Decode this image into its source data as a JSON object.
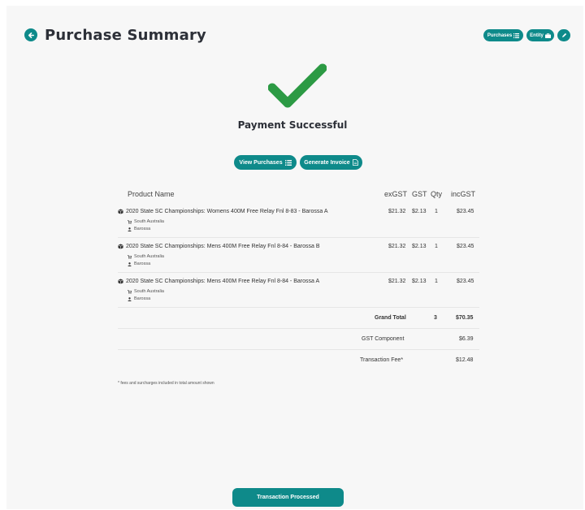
{
  "header": {
    "title": "Purchase Summary",
    "back_icon": "arrow-left-icon",
    "nav_purchases_label": "Purchases",
    "nav_entity_label": "Entity"
  },
  "status": {
    "message": "Payment Successful",
    "icon": "checkmark-icon",
    "success_color": "#2c9a44"
  },
  "actions": {
    "view_purchases_label": "View Purchases",
    "generate_invoice_label": "Generate Invoice"
  },
  "table": {
    "columns": {
      "product": "Product Name",
      "ex_gst": "exGST",
      "gst": "GST",
      "qty": "Qty",
      "inc_gst": "incGST"
    },
    "rows": [
      {
        "name": "2020 State SC Championships: Womens 400M Free Relay Fnl 8-83 - Barossa A",
        "region": "South Australia",
        "club": "Barossa",
        "ex_gst": "$21.32",
        "gst": "$2.13",
        "qty": "1",
        "inc_gst": "$23.45"
      },
      {
        "name": "2020 State SC Championships: Mens 400M Free Relay Fnl 8-84 - Barossa B",
        "region": "South Australia",
        "club": "Barossa",
        "ex_gst": "$21.32",
        "gst": "$2.13",
        "qty": "1",
        "inc_gst": "$23.45"
      },
      {
        "name": "2020 State SC Championships: Mens 400M Free Relay Fnl 8-84 - Barossa A",
        "region": "South Australia",
        "club": "Barossa",
        "ex_gst": "$21.32",
        "gst": "$2.13",
        "qty": "1",
        "inc_gst": "$23.45"
      }
    ],
    "summary": {
      "grand_total_label": "Grand Total",
      "grand_total_qty": "3",
      "grand_total_value": "$70.35",
      "gst_component_label": "GST Component",
      "gst_component_value": "$6.39",
      "transaction_fee_label": "Transaction Fee*",
      "transaction_fee_value": "$12.48"
    }
  },
  "footnote": "* fees and surcharges included in total amount shown",
  "footer": {
    "button_label": "Transaction Processed"
  },
  "colors": {
    "accent": "#0e8a8a",
    "title": "#2d3038"
  }
}
